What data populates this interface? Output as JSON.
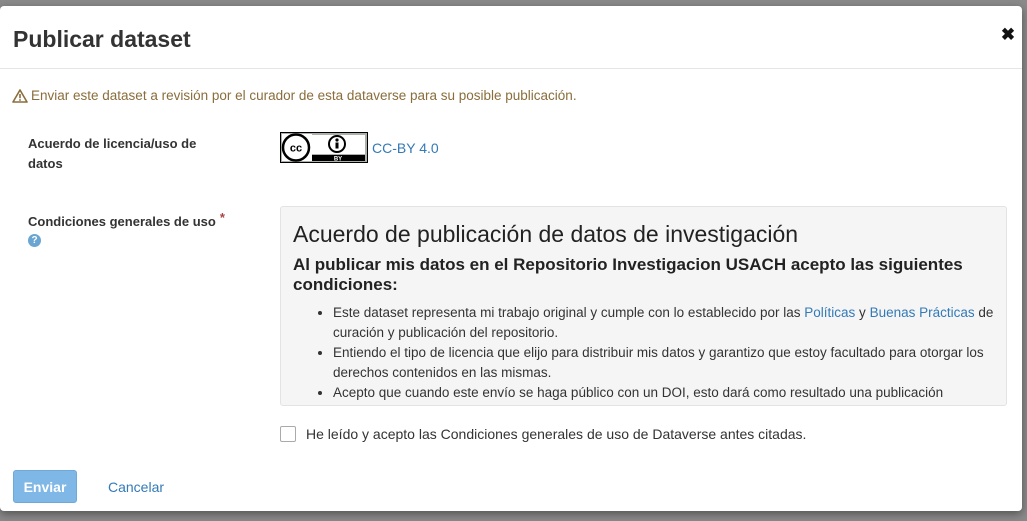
{
  "modal": {
    "title": "Publicar dataset",
    "close_icon": "close-icon"
  },
  "warning": {
    "icon": "warning-triangle-icon",
    "text": "Enviar este dataset a revisión por el curador de esta dataverse para su posible publicación."
  },
  "license": {
    "label_line1": "Acuerdo de licencia/uso de",
    "label_line2": "datos",
    "badge_icon": "cc-by-badge-icon",
    "badge_text": "BY",
    "link_text": "CC-BY 4.0"
  },
  "terms": {
    "label": "Condiciones generales de uso",
    "required_mark": "*",
    "help_icon": "question-circle-icon",
    "help_glyph": "?",
    "heading": "Acuerdo de publicación de datos de investigación",
    "subheading": "Al publicar mis datos en el Repositorio Investigacion USACH acepto las siguientes condiciones:",
    "items": [
      {
        "part1": "Este dataset representa mi trabajo original y cumple con lo establecido por las ",
        "link1": "Políticas",
        "part2": " y ",
        "link2": "Buenas Prácticas",
        "part3": " de curación y publicación del repositorio."
      },
      {
        "text": "Entiendo el tipo de licencia que elijo para distribuir mis datos y garantizo que estoy facultado para otorgar los derechos contenidos en las mismas."
      },
      {
        "text": "Acepto que cuando este envío se haga público con un DOI, esto dará como resultado una publicación"
      }
    ]
  },
  "agreement": {
    "checked": false,
    "label": "He leído y acepto las Condiciones generales de uso de Dataverse antes citadas."
  },
  "footer": {
    "submit_label": "Enviar",
    "cancel_label": "Cancelar"
  },
  "colors": {
    "primary_link": "#337ab7",
    "warning_text": "#8a6d3b",
    "submit_bg": "#7fb7e6",
    "required": "#a94442"
  }
}
